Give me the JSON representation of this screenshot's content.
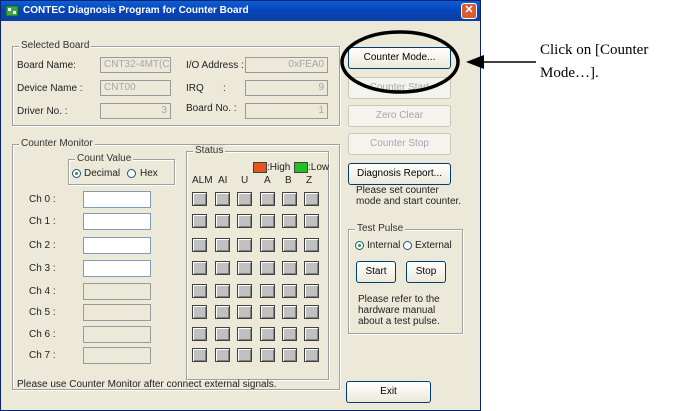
{
  "window": {
    "title": "CONTEC Diagnosis Program for Counter Board",
    "close_symbol": "✕",
    "icon": "contec-app-icon"
  },
  "selected_board": {
    "legend": "Selected Board",
    "board_name_label": "Board Name:",
    "board_name_value": "CNT32-4MT(CB",
    "device_name_label": "Device Name :",
    "device_name_value": "CNT00",
    "driver_no_label": "Driver No. :",
    "driver_no_value": "3",
    "io_address_label": "I/O Address :",
    "io_address_value": "0xFEA0",
    "irq_label": "IRQ",
    "irq_colon": ":",
    "irq_value": "9",
    "board_no_label": "Board No. :",
    "board_no_value": "1"
  },
  "buttons": {
    "counter_mode": "Counter Mode...",
    "counter_start": "Counter Start",
    "zero_clear": "Zero Clear",
    "counter_stop": "Counter Stop",
    "diagnosis_report": "Diagnosis Report...",
    "exit": "Exit"
  },
  "hint_text": "Please set counter mode and start counter.",
  "counter_monitor": {
    "legend": "Counter Monitor",
    "count_value_legend": "Count Value",
    "decimal_label": "Decimal",
    "hex_label": "Hex",
    "selected_format": "Decimal",
    "channels": [
      "Ch 0 :",
      "Ch 1 :",
      "Ch 2 :",
      "Ch 3 :",
      "Ch 4 :",
      "Ch 5 :",
      "Ch 6 :",
      "Ch 7 :"
    ],
    "status_legend": "Status",
    "high_label": ":High",
    "low_label": ":Low",
    "high_color": "#e8541e",
    "low_color": "#22c022",
    "status_columns": [
      "ALM",
      "AI",
      "U",
      "A",
      "B",
      "Z"
    ],
    "footer_note": "Please use Counter Monitor after connect external signals."
  },
  "test_pulse": {
    "legend": "Test Pulse",
    "internal_label": "Internal",
    "external_label": "External",
    "selected": "Internal",
    "start_label": "Start",
    "stop_label": "Stop",
    "note": "Please refer to the hardware manual about a test pulse."
  },
  "annotation": {
    "line1": "Click on [Counter",
    "line2": "Mode…]."
  }
}
